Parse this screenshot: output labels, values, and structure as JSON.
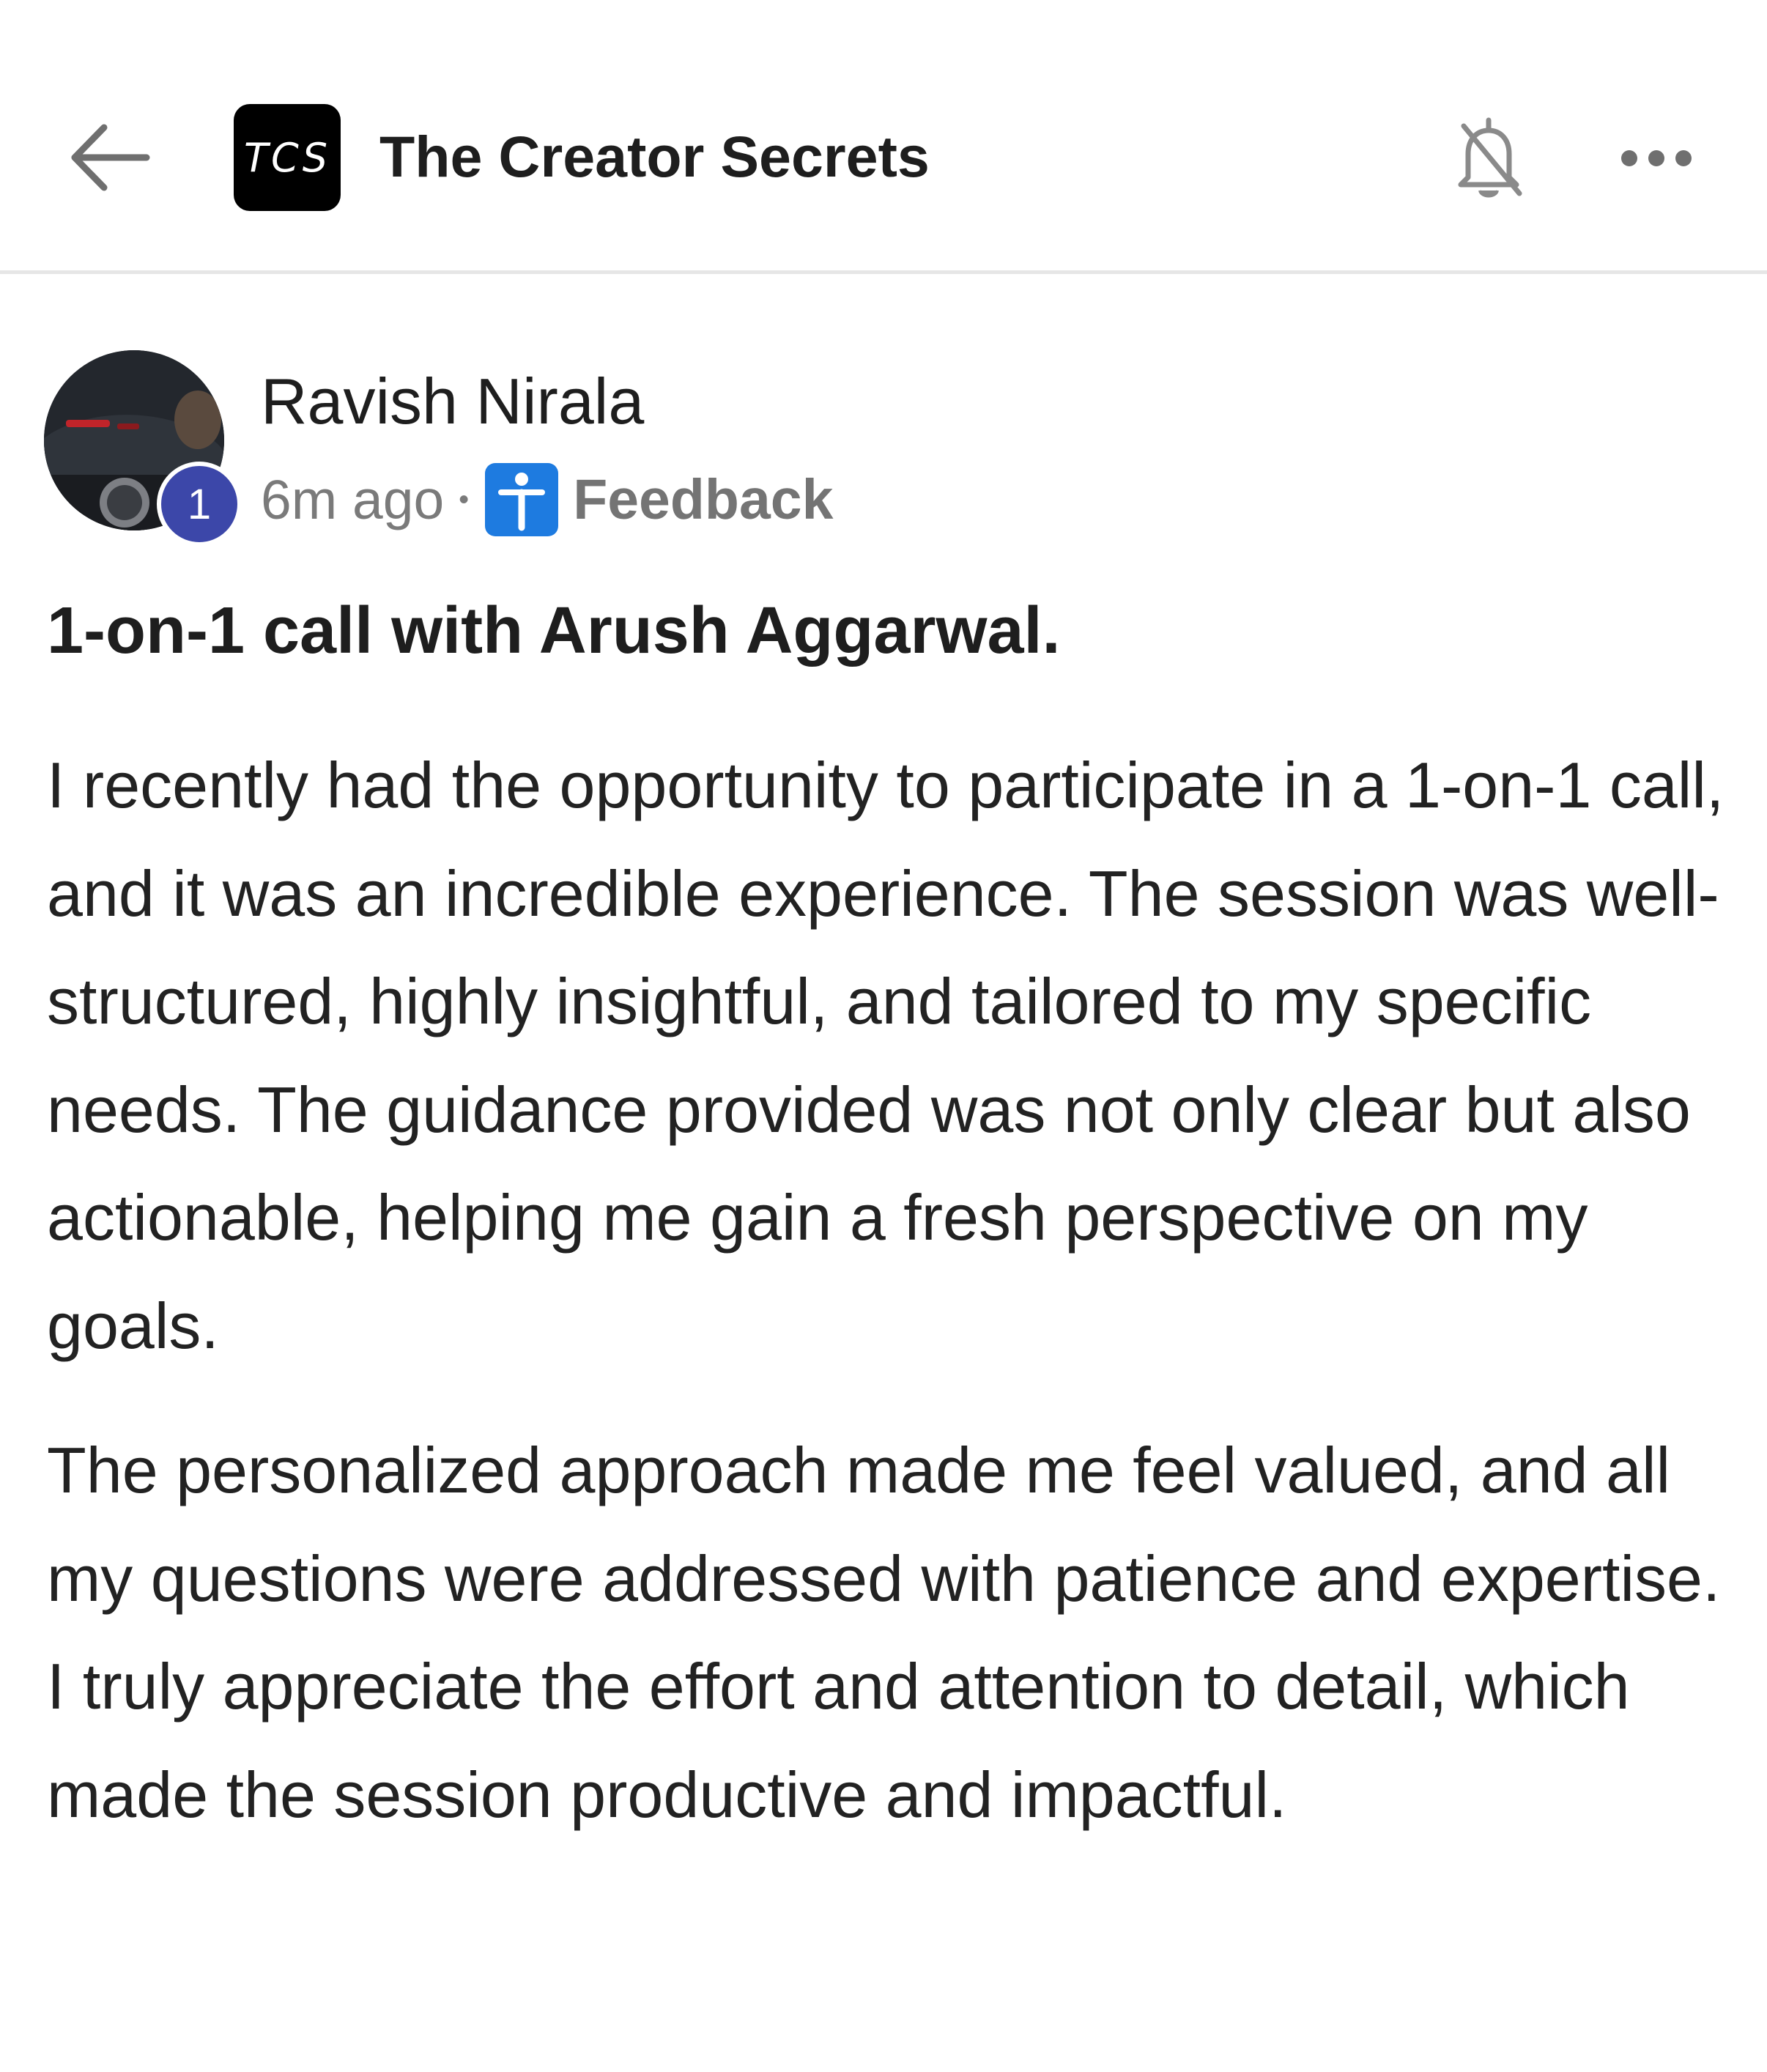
{
  "header": {
    "logo_text": "TCS",
    "title": "The Creator Secrets",
    "icons": {
      "back": "arrow-left-icon",
      "notifications": "bell-off-icon",
      "more": "more-horizontal-icon"
    }
  },
  "post": {
    "author": "Ravish Nirala",
    "badge_count": "1",
    "time": "6m ago",
    "separator": "•",
    "tag": {
      "label": "Feedback",
      "icon": "accessibility-icon",
      "color": "#1e7be0"
    },
    "title": "1-on-1 call with Arush Aggarwal.",
    "paragraphs": [
      "I recently had the opportunity to participate in a 1-on-1 call, and it was an incredible experience. The session was well-structured, highly insightful, and tailored to my specific needs. The guidance provided was not only clear but also actionable, helping me gain a fresh perspective on my goals.",
      "The personalized approach made me feel valued, and all my questions were addressed with patience and expertise. I truly appreciate the effort and attention to detail, which made the session productive and impactful."
    ]
  },
  "colors": {
    "badge": "#3c47a9",
    "logo_bg": "#000000"
  }
}
